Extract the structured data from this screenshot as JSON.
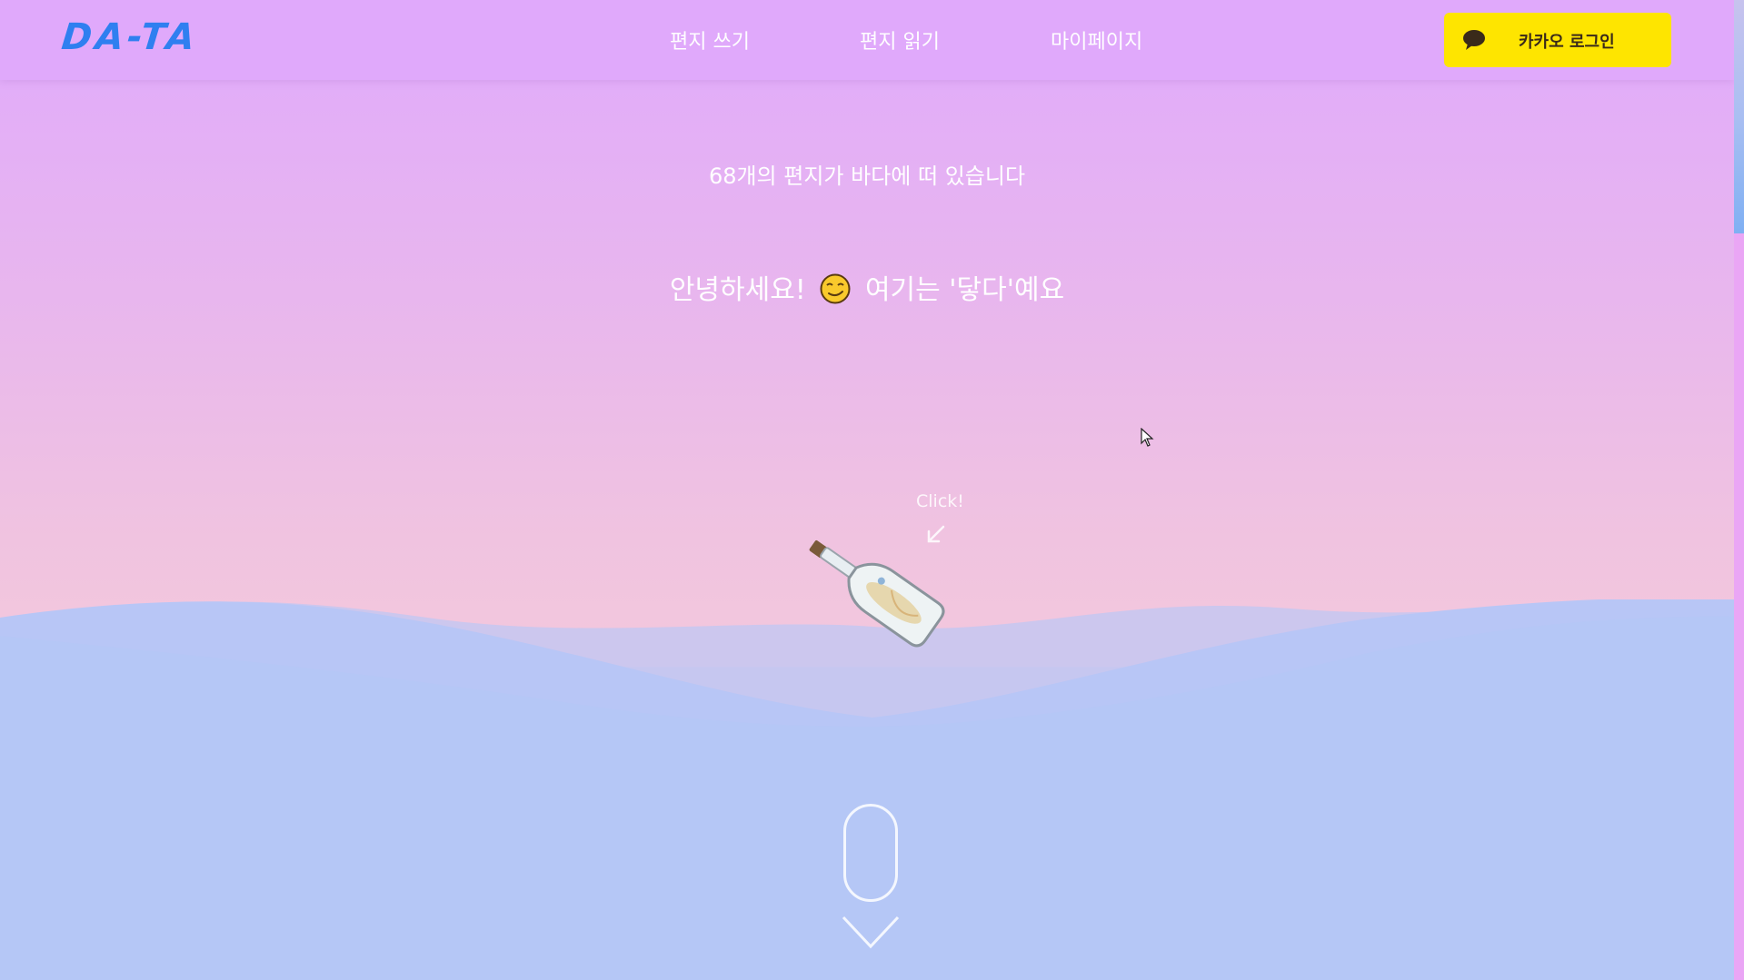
{
  "header": {
    "logo": "DA-TA",
    "nav": {
      "write": "편지 쓰기",
      "read": "편지 읽기",
      "mypage": "마이페이지"
    },
    "login_label": "카카오 로그인",
    "login_icon": "speech-bubble-icon"
  },
  "main": {
    "letter_count_text": "68개의 편지가 바다에 떠 있습니다",
    "greeting_before": "안녕하세요!",
    "greeting_emoji": "smirk-face-emoji",
    "greeting_after": "여기는 '닿다'예요",
    "click_hint": "Click!",
    "bottle_icon": "message-in-bottle-icon",
    "scroll_indicator_icon": "mouse-scroll-icon"
  },
  "colors": {
    "header_bg": "#e0a9fb",
    "logo": "#2f7ff0",
    "kakao_yellow": "#fee500",
    "sea": "#b5c7f6"
  }
}
